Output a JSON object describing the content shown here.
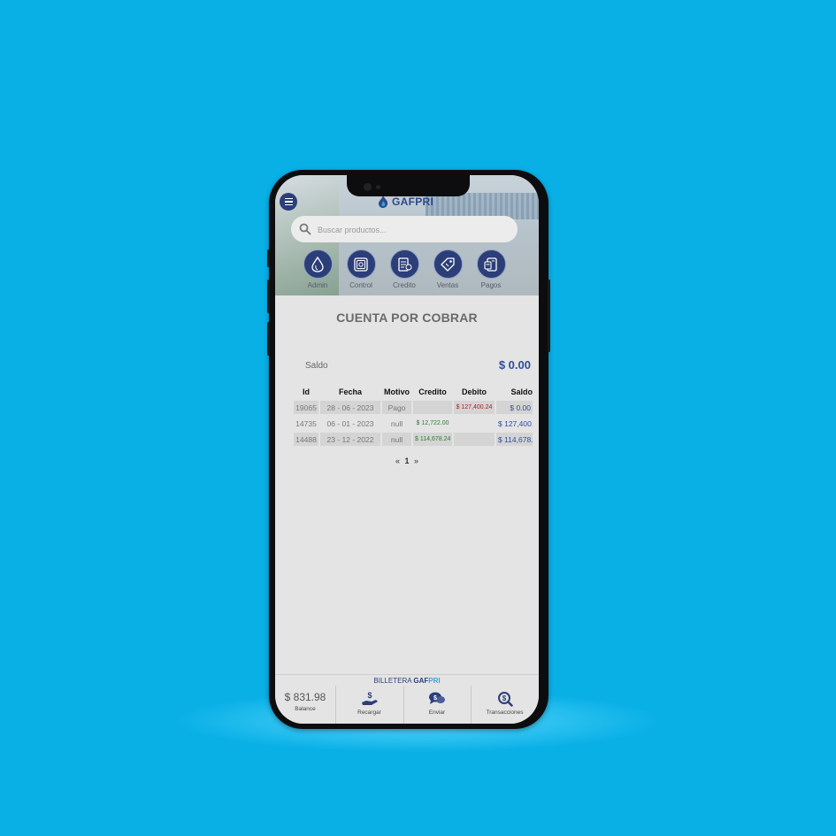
{
  "app": {
    "logo_text": "GAFPRI",
    "search_placeholder": "Buscar productos..."
  },
  "categories": [
    {
      "label": "Admin",
      "icon": "drop-icon"
    },
    {
      "label": "Control",
      "icon": "safe-icon"
    },
    {
      "label": "Credito",
      "icon": "invoice-icon"
    },
    {
      "label": "Ventas",
      "icon": "tag-icon"
    },
    {
      "label": "Pagos",
      "icon": "payment-icon"
    }
  ],
  "page": {
    "title": "CUENTA POR COBRAR",
    "saldo_label": "Saldo",
    "saldo_value": "$ 0.00"
  },
  "table": {
    "headers": [
      "Id",
      "Fecha",
      "Motivo",
      "Credito",
      "Debito",
      "Saldo"
    ],
    "rows": [
      {
        "id": "19065",
        "fecha": "28 - 06 - 2023",
        "motivo": "Pago",
        "credito": "",
        "debito": "$ 127,400.24",
        "saldo": "$ 0.00"
      },
      {
        "id": "14735",
        "fecha": "06 - 01 - 2023",
        "motivo": "null",
        "credito": "$ 12,722.00",
        "debito": "",
        "saldo": "$ 127,400."
      },
      {
        "id": "14488",
        "fecha": "23 - 12 - 2022",
        "motivo": "null",
        "credito": "$ 114,678.24",
        "debito": "",
        "saldo": "$ 114,678."
      }
    ]
  },
  "pagination": {
    "prev": "«",
    "current": "1",
    "next": "»"
  },
  "wallet": {
    "title_prefix": "BILLETERA ",
    "title_brand_a": "GAF",
    "title_brand_b": "PRI",
    "balance_value": "$ 831.98",
    "balance_label": "Balance",
    "recargar_label": "Recargar",
    "enviar_label": "Enviar",
    "transacciones_label": "Transacciones"
  },
  "colors": {
    "background": "#08b0e6",
    "brand": "#2c3e78",
    "credit": "#2e7d32",
    "debit": "#b71c1c",
    "balance": "#2e4e9c"
  }
}
